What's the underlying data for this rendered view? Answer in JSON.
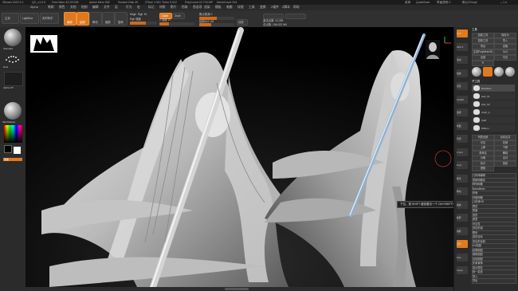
{
  "window": {
    "title_items": [
      "ZBrush 2022.0.1",
      "QC_v1.0.0",
      "Free Mem 43.297GB",
      "Active Mem 952",
      "Scratch Disk 49",
      "ZTime 1.901 Timer 0.012",
      "PolyCount 42.778 MP",
      "MeshCount 244"
    ],
    "right_items": [
      "菜单",
      "QuickSave",
      "界面透明 0",
      "默认ZScript"
    ]
  },
  "menu": [
    "Alpha",
    "笔刷",
    "颜色",
    "文档",
    "绘制",
    "编辑",
    "文件",
    "层",
    "灯光",
    "宏",
    "标记",
    "材质",
    "影片",
    "拾取",
    "首选项",
    "渲染",
    "模板",
    "笔触",
    "纹理",
    "工具",
    "变换",
    "Z插件",
    "Z脚本",
    "帮助"
  ],
  "toolbar": {
    "home_label": "主页",
    "lightbox_label": "LightBox",
    "live_boolean": "实时布尔",
    "edit_label": "编辑",
    "draw_label": "绘制",
    "move_label": "移动",
    "scale_label": "缩放",
    "rotate_label": "旋转",
    "mrgb": "Mrgb",
    "rgb": "Rgb",
    "m": "M",
    "rgb_intensity": "Rgb 强度",
    "zadd": "Zadd",
    "zsub": "Zsub",
    "z_intensity_label": "Z 强度 27",
    "z_intensity_value": 0.27,
    "focal_shift_label": "焦点衰减 0",
    "focal_shift_value": 0.5,
    "draw_size_label": "绘制大小 64",
    "draw_size_value": 0.35,
    "dynamic": "动态",
    "active_points": "激活点数: 41,281",
    "total_points": "总点数: 156.022 Mil"
  },
  "left_panel": {
    "brush_label": "Standard",
    "stroke_label": "Dots",
    "alpha_label": "Alpha Off",
    "material_label": "SkinShade4",
    "swatch_label": "渐变",
    "colors": [
      "#ffffff",
      "#000000"
    ],
    "accent": "#e07a1e"
  },
  "viewport": {
    "tooltip": "下拉，按 SHIFT 键查看另一个 Ctrl+SHIFT+Alt 键提示"
  },
  "right_tools": [
    "BPR",
    "SPix 3",
    "滚动",
    "缩放",
    "实际",
    "AAHalf",
    "透视",
    "地面",
    "局部",
    "L.Sym",
    "Gxyz",
    "框架",
    "移动",
    "缩放",
    "旋转",
    "线框",
    "透明",
    "Solo",
    "Xpose"
  ],
  "right_panel": {
    "header": "工具",
    "items": [
      "加载工具",
      "保存为",
      "复制工具",
      "导入",
      "导出",
      "克隆",
      "生成PolyMesh3D",
      "GoZ",
      "全部",
      "可见",
      "R"
    ],
    "subtool_header": "子工具",
    "subtools": [
      "Bodyface",
      "Hair_01",
      "Hair_02",
      "Cloth_A",
      "Staff",
      "Ribbon"
    ],
    "actions": [
      "列表全部",
      "自动合并",
      "可见",
      "复制",
      "上移",
      "下移",
      "重命名",
      "删除",
      "分离",
      "合并",
      "拆分",
      "投影",
      "提取"
    ],
    "lower": [
      "几何体编辑",
      "重新网格化",
      "阵列网格",
      "NanoMesh",
      "布局",
      "纤维网格",
      "几何体HD",
      "预览",
      "表面",
      "变形",
      "遮罩",
      "可见性",
      "多边形组",
      "联系",
      "变形目标",
      "多边形绘制",
      "UV贴图",
      "纹理贴图",
      "置换贴图",
      "法线贴图",
      "矢量置换",
      "显示属性",
      "统一蒙皮",
      "导入",
      "导出"
    ]
  }
}
